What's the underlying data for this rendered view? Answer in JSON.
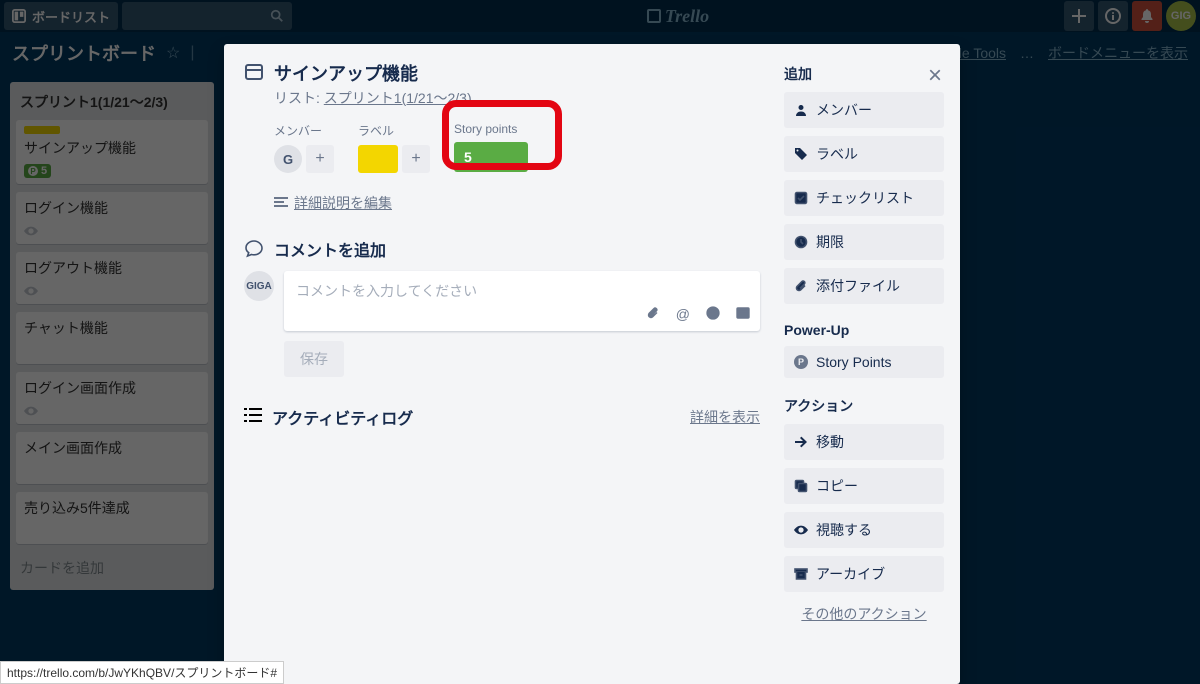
{
  "topbar": {
    "boards_btn": "ボードリスト",
    "logo": "Trello",
    "avatar_initials": "GIG"
  },
  "board_header": {
    "title": "スプリントボード",
    "agile_link": "le Tools",
    "menu_link": "ボードメニューを表示"
  },
  "list": {
    "title": "スプリント1(1/21～2/3)",
    "cards": [
      {
        "title": "サインアップ機能",
        "has_label": true,
        "story_points": "5"
      },
      {
        "title": "ログイン機能"
      },
      {
        "title": "ログアウト機能"
      },
      {
        "title": "チャット機能"
      },
      {
        "title": "ログイン画面作成"
      },
      {
        "title": "メイン画面作成"
      },
      {
        "title": "売り込み5件達成"
      }
    ],
    "add_card": "カードを追加"
  },
  "modal": {
    "title": "サインアップ機能",
    "list_prefix": "リスト:",
    "list_name": "スプリント1(1/21～2/3)",
    "meta": {
      "members_label": "メンバー",
      "member_initial": "G",
      "labels_label": "ラベル",
      "sp_label": "Story points",
      "sp_value": "5"
    },
    "edit_desc": "詳細説明を編集",
    "comment": {
      "title": "コメントを追加",
      "avatar": "GIGA",
      "placeholder": "コメントを入力してください",
      "save": "保存"
    },
    "activity": {
      "title": "アクティビティログ",
      "detail_link": "詳細を表示"
    },
    "sidebar": {
      "add_section": "追加",
      "members": "メンバー",
      "labels": "ラベル",
      "checklist": "チェックリスト",
      "due": "期限",
      "attachment": "添付ファイル",
      "powerup_section": "Power-Up",
      "story_points": "Story Points",
      "action_section": "アクション",
      "move": "移動",
      "copy": "コピー",
      "subscribe": "視聴する",
      "archive": "アーカイブ",
      "other": "その他のアクション"
    }
  },
  "status_url": "https://trello.com/b/JwYKhQBV/スプリントボード#"
}
